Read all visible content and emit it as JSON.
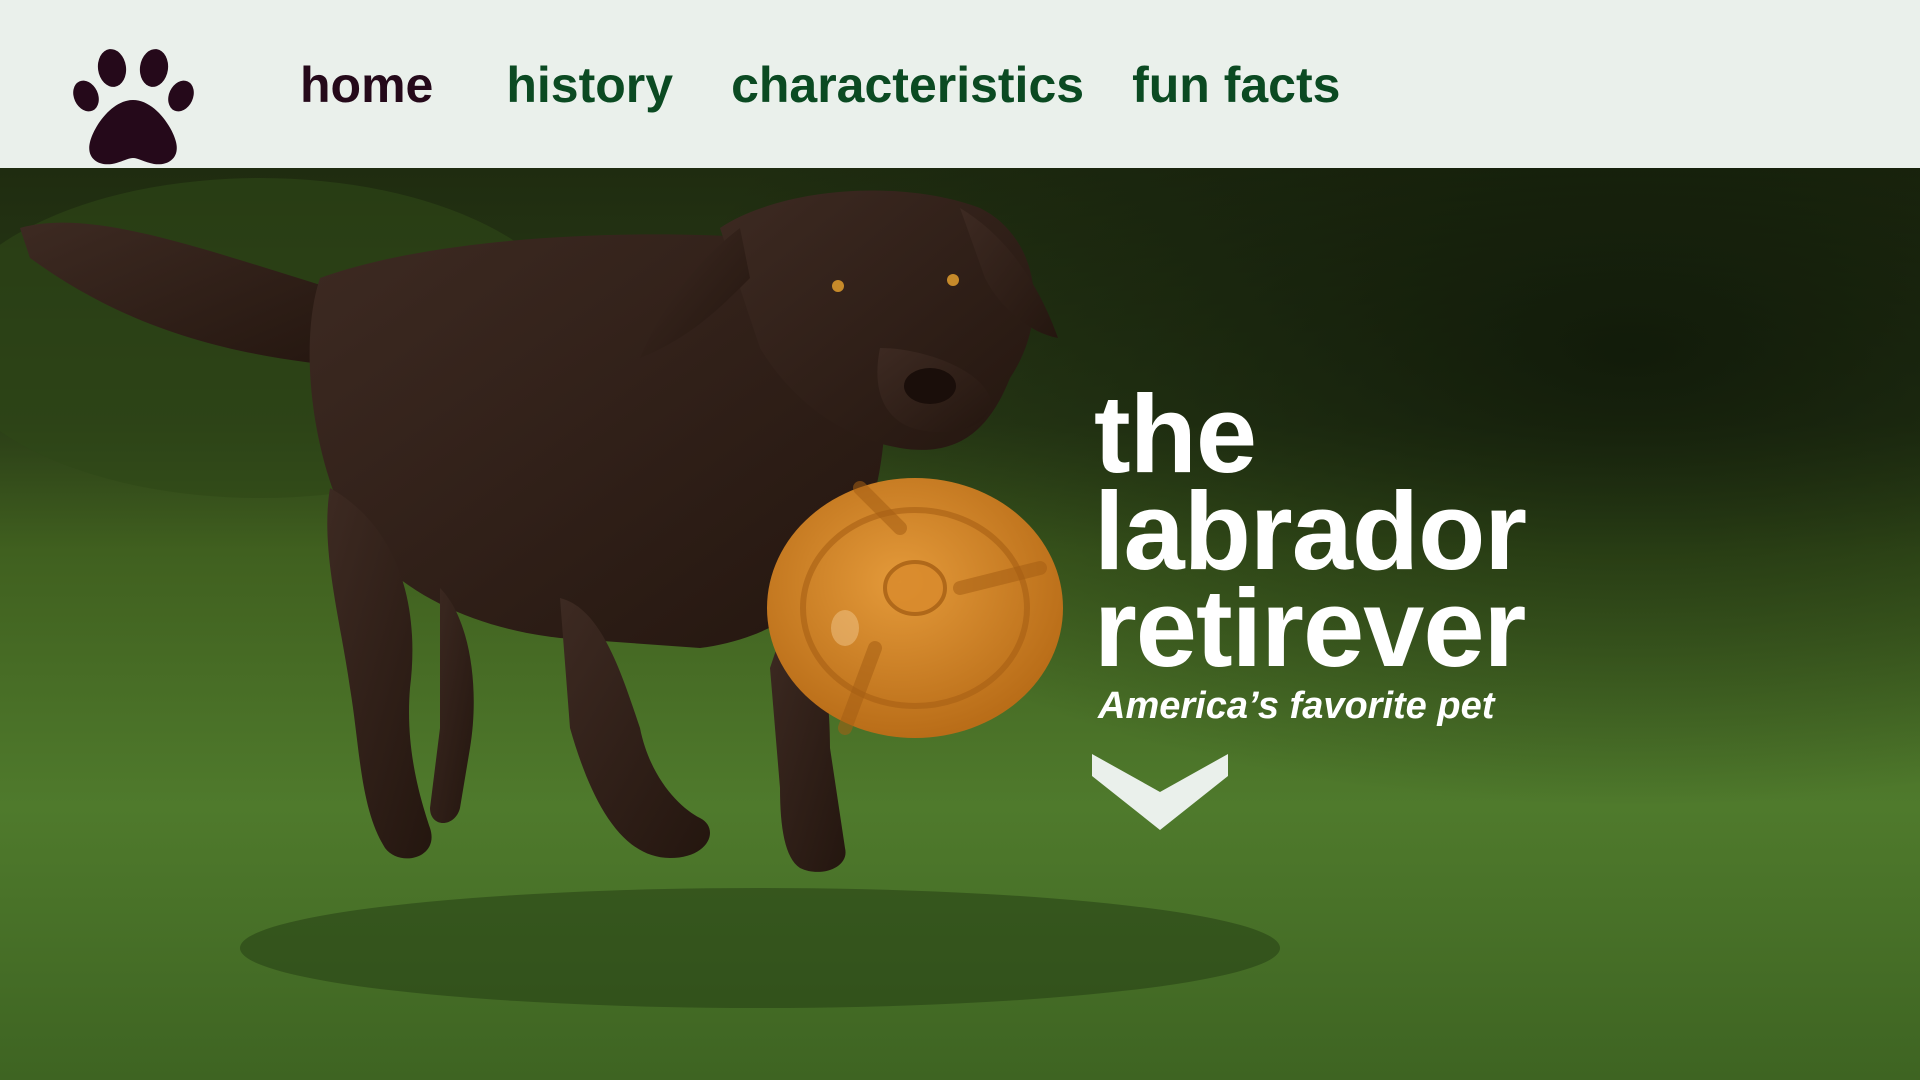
{
  "header": {
    "logo_icon": "paw-print-icon",
    "logo_color": "#25091a",
    "nav": [
      {
        "label": "home",
        "active": true
      },
      {
        "label": "history",
        "active": false
      },
      {
        "label": "characteristics",
        "active": false
      },
      {
        "label": "fun facts",
        "active": false
      }
    ],
    "nav_color": "#0b4a22",
    "nav_active_color": "#25091a",
    "background": "#eaf0eb"
  },
  "hero": {
    "title_lines": [
      "the",
      "labrador",
      "retirever"
    ],
    "subtitle": "America’s favorite pet",
    "scroll_icon": "chevron-down-icon",
    "image_subject": "chocolate labrador carrying orange frisbee on grass"
  }
}
